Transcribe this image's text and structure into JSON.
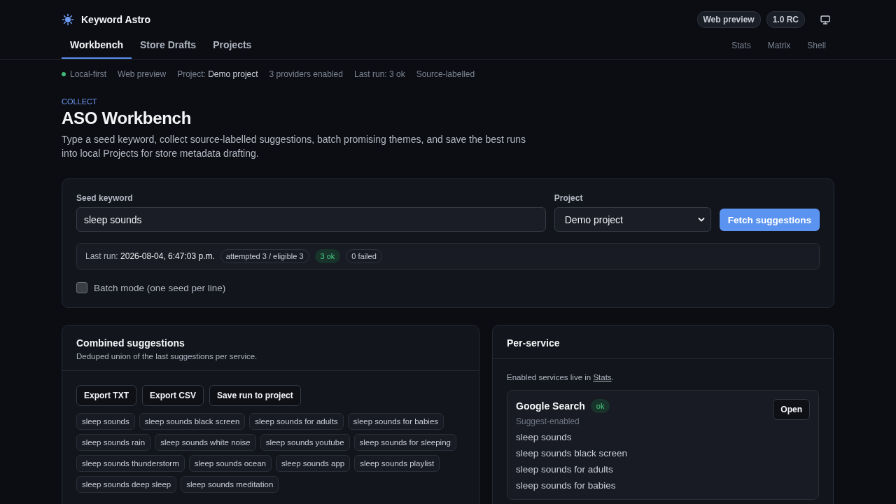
{
  "brand": {
    "name": "Keyword Astro"
  },
  "header_badges": [
    "Web preview",
    "1.0 RC"
  ],
  "tabs": [
    {
      "label": "Workbench",
      "selected": true
    },
    {
      "label": "Store Drafts",
      "selected": false
    },
    {
      "label": "Projects",
      "selected": false
    }
  ],
  "utility_links": [
    "Stats",
    "Matrix",
    "Shell"
  ],
  "status_items": [
    {
      "label": "Local-first",
      "live": true
    },
    {
      "label": "Web preview",
      "live": false
    },
    {
      "label": "Project:",
      "value": "Demo project",
      "live": false
    },
    {
      "label": "3 providers enabled",
      "live": false
    },
    {
      "label": "Last run: 3 ok",
      "live": false
    },
    {
      "label": "Source-labelled",
      "live": false
    }
  ],
  "eyebrow": "COLLECT",
  "title": "ASO Workbench",
  "intro": "Type a seed keyword, collect source-labelled suggestions, batch promising themes, and save the best runs into local Projects for store metadata drafting.",
  "form": {
    "seed_label": "Seed keyword",
    "seed_value": "sleep sounds",
    "project_label": "Project",
    "project_value": "Demo project",
    "fetch_button": "Fetch suggestions",
    "last_run": {
      "label": "Last run:",
      "value": "2026-08-04, 6:47:03 p.m.",
      "pills": [
        {
          "text": "attempted 3 / eligible 3",
          "kind": "neutral"
        },
        {
          "text": "3 ok",
          "kind": "success"
        },
        {
          "text": "0 failed",
          "kind": "neutral"
        }
      ]
    },
    "batch_mode": {
      "label": "Batch mode (one seed per line)",
      "checked": false
    }
  },
  "combined": {
    "title": "Combined suggestions",
    "subtitle": "Deduped union of the last suggestions per service.",
    "buttons": [
      "Export TXT",
      "Export CSV",
      "Save run to project"
    ],
    "chips": [
      "sleep sounds",
      "sleep sounds black screen",
      "sleep sounds for adults",
      "sleep sounds for babies",
      "sleep sounds rain",
      "sleep sounds white noise",
      "sleep sounds youtube",
      "sleep sounds for sleeping",
      "sleep sounds thunderstorm",
      "sleep sounds ocean",
      "sleep sounds app",
      "sleep sounds playlist",
      "sleep sounds deep sleep",
      "sleep sounds meditation"
    ]
  },
  "per_service": {
    "title": "Per-service",
    "note_prefix": "Enabled services live in",
    "note_link": "Stats",
    "note_suffix": ".",
    "services": [
      {
        "name": "Google Search",
        "status": {
          "text": "ok",
          "kind": "success"
        },
        "subtitle": "Suggest-enabled",
        "open_button": "Open",
        "suggestions": [
          "sleep sounds",
          "sleep sounds black screen",
          "sleep sounds for adults",
          "sleep sounds for babies"
        ]
      }
    ]
  }
}
